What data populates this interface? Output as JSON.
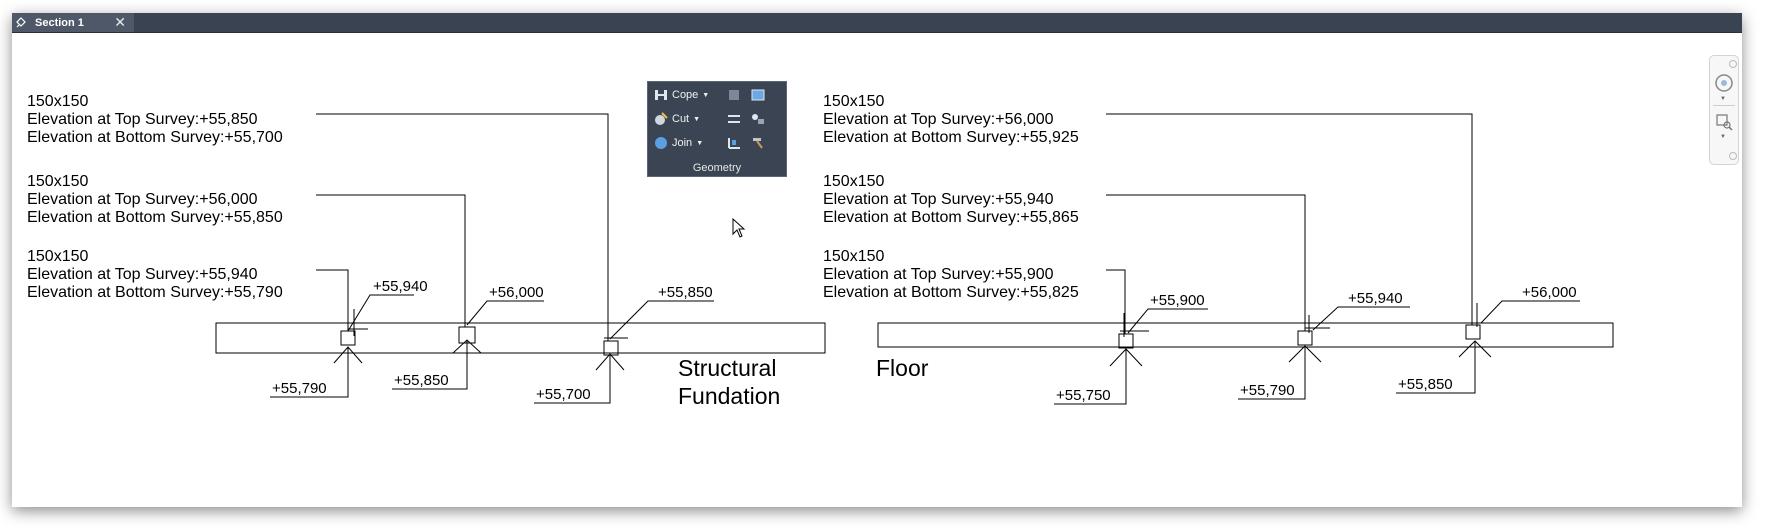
{
  "tab": {
    "title": "Section 1",
    "close_glyph": "✕",
    "pin_icon": "pin-icon"
  },
  "ribbon": {
    "panel_title": "Geometry",
    "cope_label": "Cope",
    "cut_label": "Cut",
    "join_label": "Join"
  },
  "drawing": {
    "left": {
      "label_line1": "Structural",
      "label_line2": "Fundation",
      "callouts": [
        {
          "size": "150x150",
          "top": "Elevation at Top Survey:+55,850",
          "bottom": "Elevation at Bottom Survey:+55,700"
        },
        {
          "size": "150x150",
          "top": "Elevation at Top Survey:+56,000",
          "bottom": "Elevation at Bottom Survey:+55,850"
        },
        {
          "size": "150x150",
          "top": "Elevation at Top Survey:+55,940",
          "bottom": "Elevation at Bottom Survey:+55,790"
        }
      ],
      "top_elevations": [
        "+55,940",
        "+56,000",
        "+55,850"
      ],
      "bottom_elevations": [
        "+55,790",
        "+55,850",
        "+55,700"
      ]
    },
    "right": {
      "label": "Floor",
      "callouts": [
        {
          "size": "150x150",
          "top": "Elevation at Top Survey:+56,000",
          "bottom": "Elevation at Bottom Survey:+55,925"
        },
        {
          "size": "150x150",
          "top": "Elevation at Top Survey:+55,940",
          "bottom": "Elevation at Bottom Survey:+55,865"
        },
        {
          "size": "150x150",
          "top": "Elevation at Top Survey:+55,900",
          "bottom": "Elevation at Bottom Survey:+55,825"
        }
      ],
      "top_elevations": [
        "+55,900",
        "+55,940",
        "+56,000"
      ],
      "bottom_elevations": [
        "+55,750",
        "+55,790",
        "+55,850"
      ]
    }
  },
  "navbar": {
    "icons": [
      "full-navigation-wheel-icon",
      "zoom-icon"
    ]
  }
}
